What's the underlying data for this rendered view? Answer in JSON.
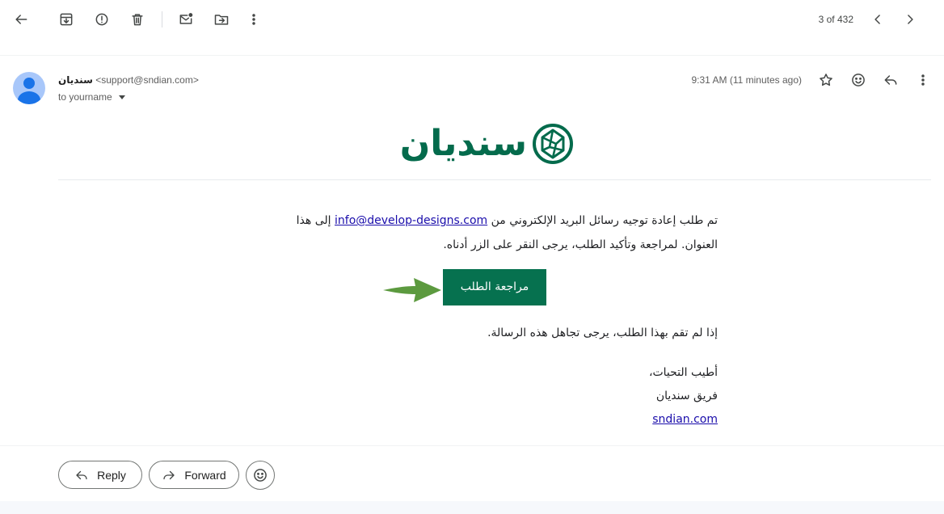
{
  "toolbar": {
    "back": "back-arrow-icon",
    "archive": "archive-icon",
    "report_spam": "report-spam-icon",
    "delete": "trash-icon",
    "mark_unread": "mark-unread-icon",
    "move_to": "move-to-folder-icon",
    "more": "more-vert-icon",
    "pager_text": "3 of 432"
  },
  "message": {
    "sender_name": "سنديان",
    "sender_email": "<support@sndian.com>",
    "to_text": "to yourname",
    "time": "9:31 AM (11 minutes ago)"
  },
  "brand": {
    "logo_text": "سنديان",
    "color": "#046b4c",
    "button_color": "#06714f",
    "arrow_color": "#5c9a3f"
  },
  "body": {
    "para1_prefix": "تم طلب إعادة توجيه رسائل البريد الإلكتروني من",
    "para1_link": "info@develop-designs.com",
    "para1_suffix": "إلى هذا العنوان. لمراجعة وتأكيد الطلب، يرجى النقر على الزر أدناه.",
    "cta_label": "مراجعة الطلب",
    "para2": "إذا لم تقم بهذا الطلب، يرجى تجاهل هذه الرسالة.",
    "sign_greeting": "أطيب التحيات،",
    "sign_team": "فريق سنديان",
    "sign_link": "sndian.com"
  },
  "actions": {
    "reply_label": "Reply",
    "forward_label": "Forward"
  }
}
